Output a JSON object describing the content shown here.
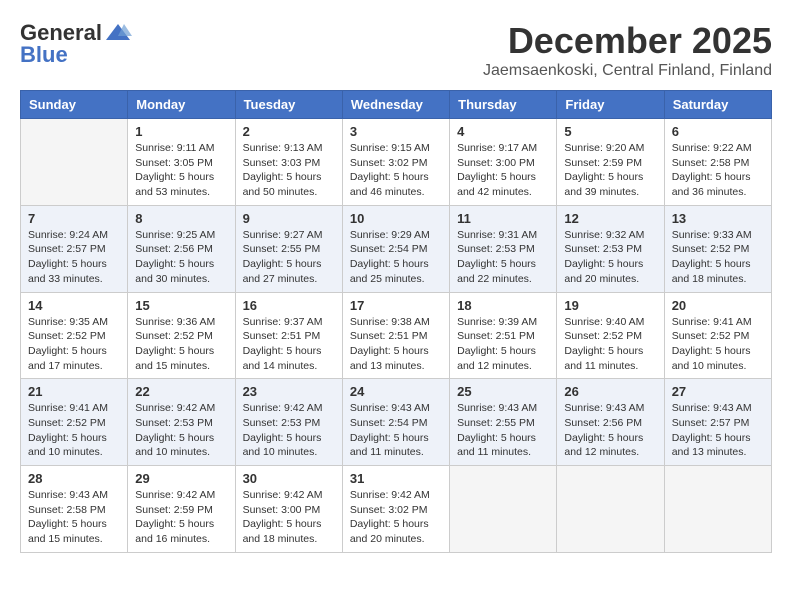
{
  "logo": {
    "general": "General",
    "blue": "Blue"
  },
  "title": "December 2025",
  "location": "Jaemsaenkoski, Central Finland, Finland",
  "weekdays": [
    "Sunday",
    "Monday",
    "Tuesday",
    "Wednesday",
    "Thursday",
    "Friday",
    "Saturday"
  ],
  "weeks": [
    [
      {
        "day": "",
        "info": ""
      },
      {
        "day": "1",
        "info": "Sunrise: 9:11 AM\nSunset: 3:05 PM\nDaylight: 5 hours\nand 53 minutes."
      },
      {
        "day": "2",
        "info": "Sunrise: 9:13 AM\nSunset: 3:03 PM\nDaylight: 5 hours\nand 50 minutes."
      },
      {
        "day": "3",
        "info": "Sunrise: 9:15 AM\nSunset: 3:02 PM\nDaylight: 5 hours\nand 46 minutes."
      },
      {
        "day": "4",
        "info": "Sunrise: 9:17 AM\nSunset: 3:00 PM\nDaylight: 5 hours\nand 42 minutes."
      },
      {
        "day": "5",
        "info": "Sunrise: 9:20 AM\nSunset: 2:59 PM\nDaylight: 5 hours\nand 39 minutes."
      },
      {
        "day": "6",
        "info": "Sunrise: 9:22 AM\nSunset: 2:58 PM\nDaylight: 5 hours\nand 36 minutes."
      }
    ],
    [
      {
        "day": "7",
        "info": "Sunrise: 9:24 AM\nSunset: 2:57 PM\nDaylight: 5 hours\nand 33 minutes."
      },
      {
        "day": "8",
        "info": "Sunrise: 9:25 AM\nSunset: 2:56 PM\nDaylight: 5 hours\nand 30 minutes."
      },
      {
        "day": "9",
        "info": "Sunrise: 9:27 AM\nSunset: 2:55 PM\nDaylight: 5 hours\nand 27 minutes."
      },
      {
        "day": "10",
        "info": "Sunrise: 9:29 AM\nSunset: 2:54 PM\nDaylight: 5 hours\nand 25 minutes."
      },
      {
        "day": "11",
        "info": "Sunrise: 9:31 AM\nSunset: 2:53 PM\nDaylight: 5 hours\nand 22 minutes."
      },
      {
        "day": "12",
        "info": "Sunrise: 9:32 AM\nSunset: 2:53 PM\nDaylight: 5 hours\nand 20 minutes."
      },
      {
        "day": "13",
        "info": "Sunrise: 9:33 AM\nSunset: 2:52 PM\nDaylight: 5 hours\nand 18 minutes."
      }
    ],
    [
      {
        "day": "14",
        "info": "Sunrise: 9:35 AM\nSunset: 2:52 PM\nDaylight: 5 hours\nand 17 minutes."
      },
      {
        "day": "15",
        "info": "Sunrise: 9:36 AM\nSunset: 2:52 PM\nDaylight: 5 hours\nand 15 minutes."
      },
      {
        "day": "16",
        "info": "Sunrise: 9:37 AM\nSunset: 2:51 PM\nDaylight: 5 hours\nand 14 minutes."
      },
      {
        "day": "17",
        "info": "Sunrise: 9:38 AM\nSunset: 2:51 PM\nDaylight: 5 hours\nand 13 minutes."
      },
      {
        "day": "18",
        "info": "Sunrise: 9:39 AM\nSunset: 2:51 PM\nDaylight: 5 hours\nand 12 minutes."
      },
      {
        "day": "19",
        "info": "Sunrise: 9:40 AM\nSunset: 2:52 PM\nDaylight: 5 hours\nand 11 minutes."
      },
      {
        "day": "20",
        "info": "Sunrise: 9:41 AM\nSunset: 2:52 PM\nDaylight: 5 hours\nand 10 minutes."
      }
    ],
    [
      {
        "day": "21",
        "info": "Sunrise: 9:41 AM\nSunset: 2:52 PM\nDaylight: 5 hours\nand 10 minutes."
      },
      {
        "day": "22",
        "info": "Sunrise: 9:42 AM\nSunset: 2:53 PM\nDaylight: 5 hours\nand 10 minutes."
      },
      {
        "day": "23",
        "info": "Sunrise: 9:42 AM\nSunset: 2:53 PM\nDaylight: 5 hours\nand 10 minutes."
      },
      {
        "day": "24",
        "info": "Sunrise: 9:43 AM\nSunset: 2:54 PM\nDaylight: 5 hours\nand 11 minutes."
      },
      {
        "day": "25",
        "info": "Sunrise: 9:43 AM\nSunset: 2:55 PM\nDaylight: 5 hours\nand 11 minutes."
      },
      {
        "day": "26",
        "info": "Sunrise: 9:43 AM\nSunset: 2:56 PM\nDaylight: 5 hours\nand 12 minutes."
      },
      {
        "day": "27",
        "info": "Sunrise: 9:43 AM\nSunset: 2:57 PM\nDaylight: 5 hours\nand 13 minutes."
      }
    ],
    [
      {
        "day": "28",
        "info": "Sunrise: 9:43 AM\nSunset: 2:58 PM\nDaylight: 5 hours\nand 15 minutes."
      },
      {
        "day": "29",
        "info": "Sunrise: 9:42 AM\nSunset: 2:59 PM\nDaylight: 5 hours\nand 16 minutes."
      },
      {
        "day": "30",
        "info": "Sunrise: 9:42 AM\nSunset: 3:00 PM\nDaylight: 5 hours\nand 18 minutes."
      },
      {
        "day": "31",
        "info": "Sunrise: 9:42 AM\nSunset: 3:02 PM\nDaylight: 5 hours\nand 20 minutes."
      },
      {
        "day": "",
        "info": ""
      },
      {
        "day": "",
        "info": ""
      },
      {
        "day": "",
        "info": ""
      }
    ]
  ]
}
